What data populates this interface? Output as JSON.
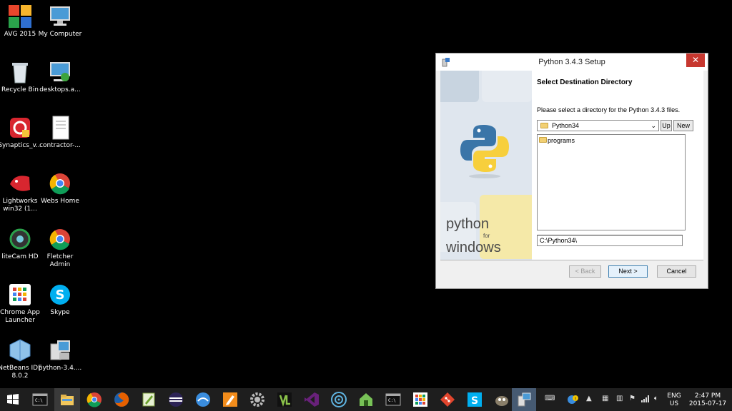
{
  "desktop": {
    "icons": [
      {
        "label": "AVG 2015",
        "icon": "avg-icon"
      },
      {
        "label": "My Computer",
        "icon": "computer-icon"
      },
      {
        "label": "Recycle Bin",
        "icon": "recycle-bin-icon"
      },
      {
        "label": "desktops.a...",
        "icon": "network-computer-icon"
      },
      {
        "label": "Synaptics_v...",
        "icon": "synaptics-installer-icon"
      },
      {
        "label": "contractor-...",
        "icon": "document-icon"
      },
      {
        "label": "Lightworks win32 (1...",
        "icon": "lightworks-icon"
      },
      {
        "label": "Webs Home",
        "icon": "chrome-icon"
      },
      {
        "label": "liteCam HD",
        "icon": "litecam-icon"
      },
      {
        "label": "Fletcher Admin",
        "icon": "chrome-icon"
      },
      {
        "label": "Chrome App Launcher",
        "icon": "app-launcher-icon"
      },
      {
        "label": "Skype",
        "icon": "skype-icon"
      },
      {
        "label": "NetBeans IDE 8.0.2",
        "icon": "netbeans-icon"
      },
      {
        "label": "python-3.4....",
        "icon": "installer-icon"
      }
    ]
  },
  "dialog": {
    "title": "Python 3.4.3 Setup",
    "close_label": "✕",
    "banner": {
      "brand_top": "python",
      "brand_for": "for",
      "brand_bottom": "windows"
    },
    "heading": "Select Destination Directory",
    "description": "Please select a directory for the Python 3.4.3 files.",
    "directory_select_value": "Python34",
    "up_label": "Up",
    "new_label": "New",
    "folder_list": [
      "programs"
    ],
    "path_value": "C:\\Python34\\",
    "back_label": "< Back",
    "next_label": "Next >",
    "cancel_label": "Cancel"
  },
  "taskbar": {
    "items": [
      "windows-start-icon",
      "command-prompt-icon",
      "file-explorer-icon",
      "chrome-icon",
      "firefox-icon",
      "notepad-plus-icon",
      "eclipse-icon",
      "fiddler-icon",
      "pencil-icon",
      "settings-gear-icon",
      "vlc-icon",
      "visual-studio-icon",
      "atom-icon",
      "android-icon",
      "command-prompt-icon",
      "app-launcher-icon",
      "git-icon",
      "skype-icon",
      "gimp-icon",
      "installer-icon"
    ],
    "language": "ENG",
    "region": "US",
    "time": "2:47 PM",
    "date": "2015-07-17"
  }
}
